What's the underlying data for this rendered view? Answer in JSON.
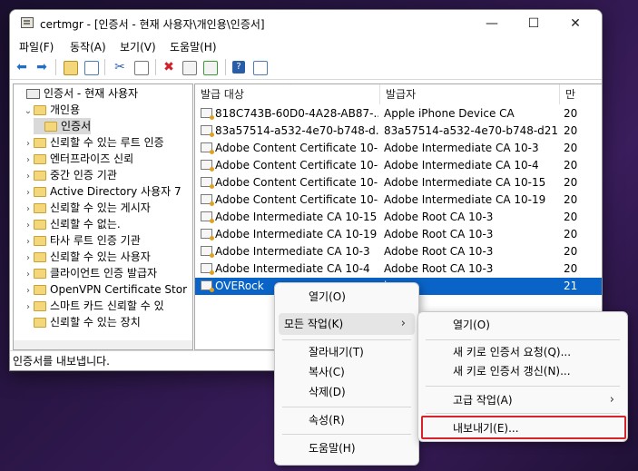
{
  "window": {
    "title": "certmgr - [인증서 - 현재 사용자\\개인용\\인증서]",
    "minimize_glyph": "—",
    "maximize_glyph": "☐",
    "close_glyph": "✕"
  },
  "menubar": [
    "파일(F)",
    "동작(A)",
    "보기(V)",
    "도움말(H)"
  ],
  "toolbar_icons": [
    "back-arrow-icon",
    "forward-arrow-icon",
    "up-folder-icon",
    "show-hide-tree-icon",
    "cut-icon",
    "copy-icon",
    "delete-icon",
    "properties-icon",
    "export-list-icon",
    "help-icon",
    "console-view-icon"
  ],
  "tree": [
    {
      "label": "인증서 - 현재 사용자",
      "level": 0,
      "expander": ""
    },
    {
      "label": "개인용",
      "level": 1,
      "expander": "⌄"
    },
    {
      "label": "인증서",
      "level": 2,
      "expander": "",
      "selected": true
    },
    {
      "label": "신뢰할 수 있는 루트 인증",
      "level": 1,
      "expander": "›"
    },
    {
      "label": "엔터프라이즈 신뢰",
      "level": 1,
      "expander": "›"
    },
    {
      "label": "중간 인증 기관",
      "level": 1,
      "expander": "›"
    },
    {
      "label": "Active Directory 사용자 7",
      "level": 1,
      "expander": "›"
    },
    {
      "label": "신뢰할 수 있는 게시자",
      "level": 1,
      "expander": "›"
    },
    {
      "label": "신뢰할 수 없는.",
      "level": 1,
      "expander": "›"
    },
    {
      "label": "타사 루트 인증 기관",
      "level": 1,
      "expander": "›"
    },
    {
      "label": "신뢰할 수 있는 사용자",
      "level": 1,
      "expander": "›"
    },
    {
      "label": "클라이언트 인증 발급자",
      "level": 1,
      "expander": "›"
    },
    {
      "label": "OpenVPN Certificate Stor",
      "level": 1,
      "expander": "›"
    },
    {
      "label": "스마트 카드 신뢰할 수 있",
      "level": 1,
      "expander": "›"
    },
    {
      "label": "신뢰할 수 있는 장치",
      "level": 1,
      "expander": ""
    }
  ],
  "list": {
    "columns": [
      "발급 대상",
      "발급자",
      "만"
    ],
    "sort_glyph": "⌃",
    "rows": [
      {
        "issued_to": "818C743B-60D0-4A28-AB87-...",
        "issued_by": "Apple iPhone Device CA",
        "exp": "20"
      },
      {
        "issued_to": "83a57514-a532-4e70-b748-d...",
        "issued_by": "83a57514-a532-4e70-b748-d21...",
        "exp": "20"
      },
      {
        "issued_to": "Adobe Content Certificate 10-5",
        "issued_by": "Adobe Intermediate CA 10-3",
        "exp": "20"
      },
      {
        "issued_to": "Adobe Content Certificate 10-6",
        "issued_by": "Adobe Intermediate CA 10-4",
        "exp": "20"
      },
      {
        "issued_to": "Adobe Content Certificate 10-7",
        "issued_by": "Adobe Intermediate CA 10-15",
        "exp": "20"
      },
      {
        "issued_to": "Adobe Content Certificate 10-8",
        "issued_by": "Adobe Intermediate CA 10-19",
        "exp": "20"
      },
      {
        "issued_to": "Adobe Intermediate CA 10-15",
        "issued_by": "Adobe Root CA 10-3",
        "exp": "20"
      },
      {
        "issued_to": "Adobe Intermediate CA 10-19",
        "issued_by": "Adobe Root CA 10-3",
        "exp": "20"
      },
      {
        "issued_to": "Adobe Intermediate CA 10-3",
        "issued_by": "Adobe Root CA 10-3",
        "exp": "20"
      },
      {
        "issued_to": "Adobe Intermediate CA 10-4",
        "issued_by": "Adobe Root CA 10-3",
        "exp": "20"
      },
      {
        "issued_to": "OVERock",
        "issued_by": "k",
        "exp": "21",
        "selected": true
      }
    ]
  },
  "status": "인증서를 내보냅니다.",
  "context_menu": {
    "items": [
      "열기(O)",
      "모든 작업(K)",
      "잘라내기(T)",
      "복사(C)",
      "삭제(D)",
      "속성(R)",
      "도움말(H)"
    ]
  },
  "submenu": {
    "items": [
      "열기(O)",
      "새 키로 인증서 요청(Q)...",
      "새 키로 인증서 갱신(N)...",
      "고급 작업(A)",
      "내보내기(E)..."
    ]
  },
  "chevron_glyph": "›",
  "colors": {
    "selection": "#0a64c8",
    "export_outline": "#d9232b"
  }
}
